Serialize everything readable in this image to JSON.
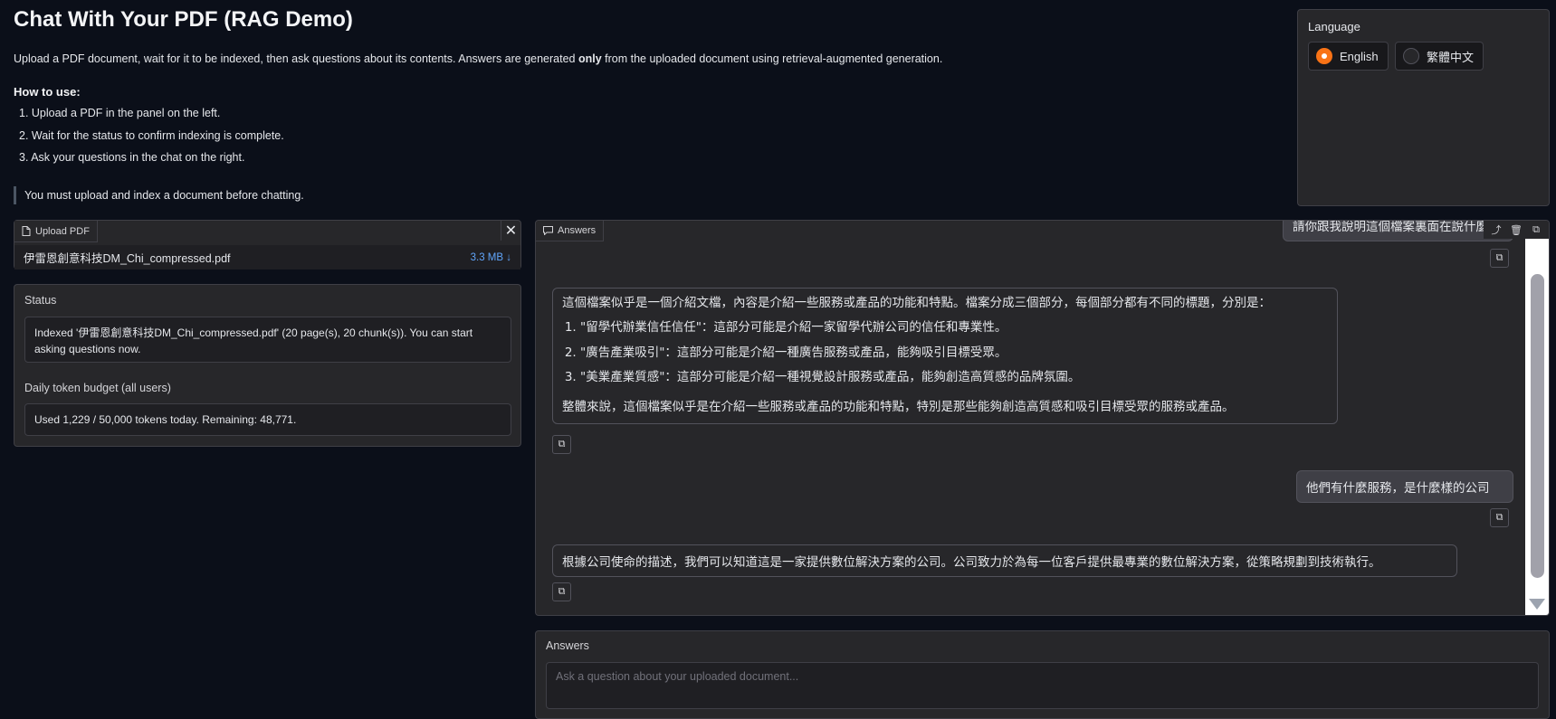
{
  "header": {
    "title": "Chat With Your PDF (RAG Demo)",
    "intro_before": "Upload a PDF document, wait for it to be indexed, then ask questions about its contents. Answers are generated ",
    "intro_bold": "only",
    "intro_after": " from the uploaded document using retrieval-augmented generation.",
    "howto_title": "How to use:",
    "steps": [
      "1. Upload a PDF in the panel on the left.",
      "2. Wait for the status to confirm indexing is complete.",
      "3. Ask your questions in the chat on the right."
    ],
    "note": "You must upload and index a document before chatting."
  },
  "language": {
    "label": "Language",
    "options": [
      {
        "label": "English",
        "selected": true
      },
      {
        "label": "繁體中文",
        "selected": false
      }
    ]
  },
  "upload": {
    "tab_label": "Upload PDF",
    "file_name": "伊雷恩創意科技DM_Chi_compressed.pdf",
    "file_size": "3.3 MB ↓"
  },
  "status": {
    "label": "Status",
    "text": "Indexed '伊雷恩創意科技DM_Chi_compressed.pdf' (20 page(s), 20 chunk(s)). You can start asking questions now.",
    "budget_label": "Daily token budget (all users)",
    "budget_text": "Used 1,229 / 50,000 tokens today. Remaining: 48,771."
  },
  "chat": {
    "tab_label": "Answers",
    "messages": {
      "user1": "請你跟我說明這個檔案裏面在說什麼",
      "bot1_intro": "這個檔案似乎是一個介紹文檔，內容是介紹一些服務或產品的功能和特點。檔案分成三個部分，每個部分都有不同的標題，分別是：",
      "bot1_items": [
        "\"留學代辦業信任信任\"：這部分可能是介紹一家留學代辦公司的信任和專業性。",
        "\"廣告產業吸引\"：這部分可能是介紹一種廣告服務或產品，能夠吸引目標受眾。",
        "\"美業產業質感\"：這部分可能是介紹一種視覺設計服務或產品，能夠創造高質感的品牌氛圍。"
      ],
      "bot1_summary": "整體來說，這個檔案似乎是在介紹一些服務或產品的功能和特點，特別是那些能夠創造高質感和吸引目標受眾的服務或產品。",
      "user2": "他們有什麼服務，是什麼樣的公司",
      "bot2": "根據公司使命的描述，我們可以知道這是一家提供數位解決方案的公司。公司致力於為每一位客戶提供最專業的數位解決方案，從策略規劃到技術執行。"
    }
  },
  "ask": {
    "label": "Answers",
    "placeholder": "Ask a question about your uploaded document..."
  },
  "colors": {
    "accent": "#f97316",
    "link": "#60a5fa",
    "background": "#0b0f19"
  }
}
